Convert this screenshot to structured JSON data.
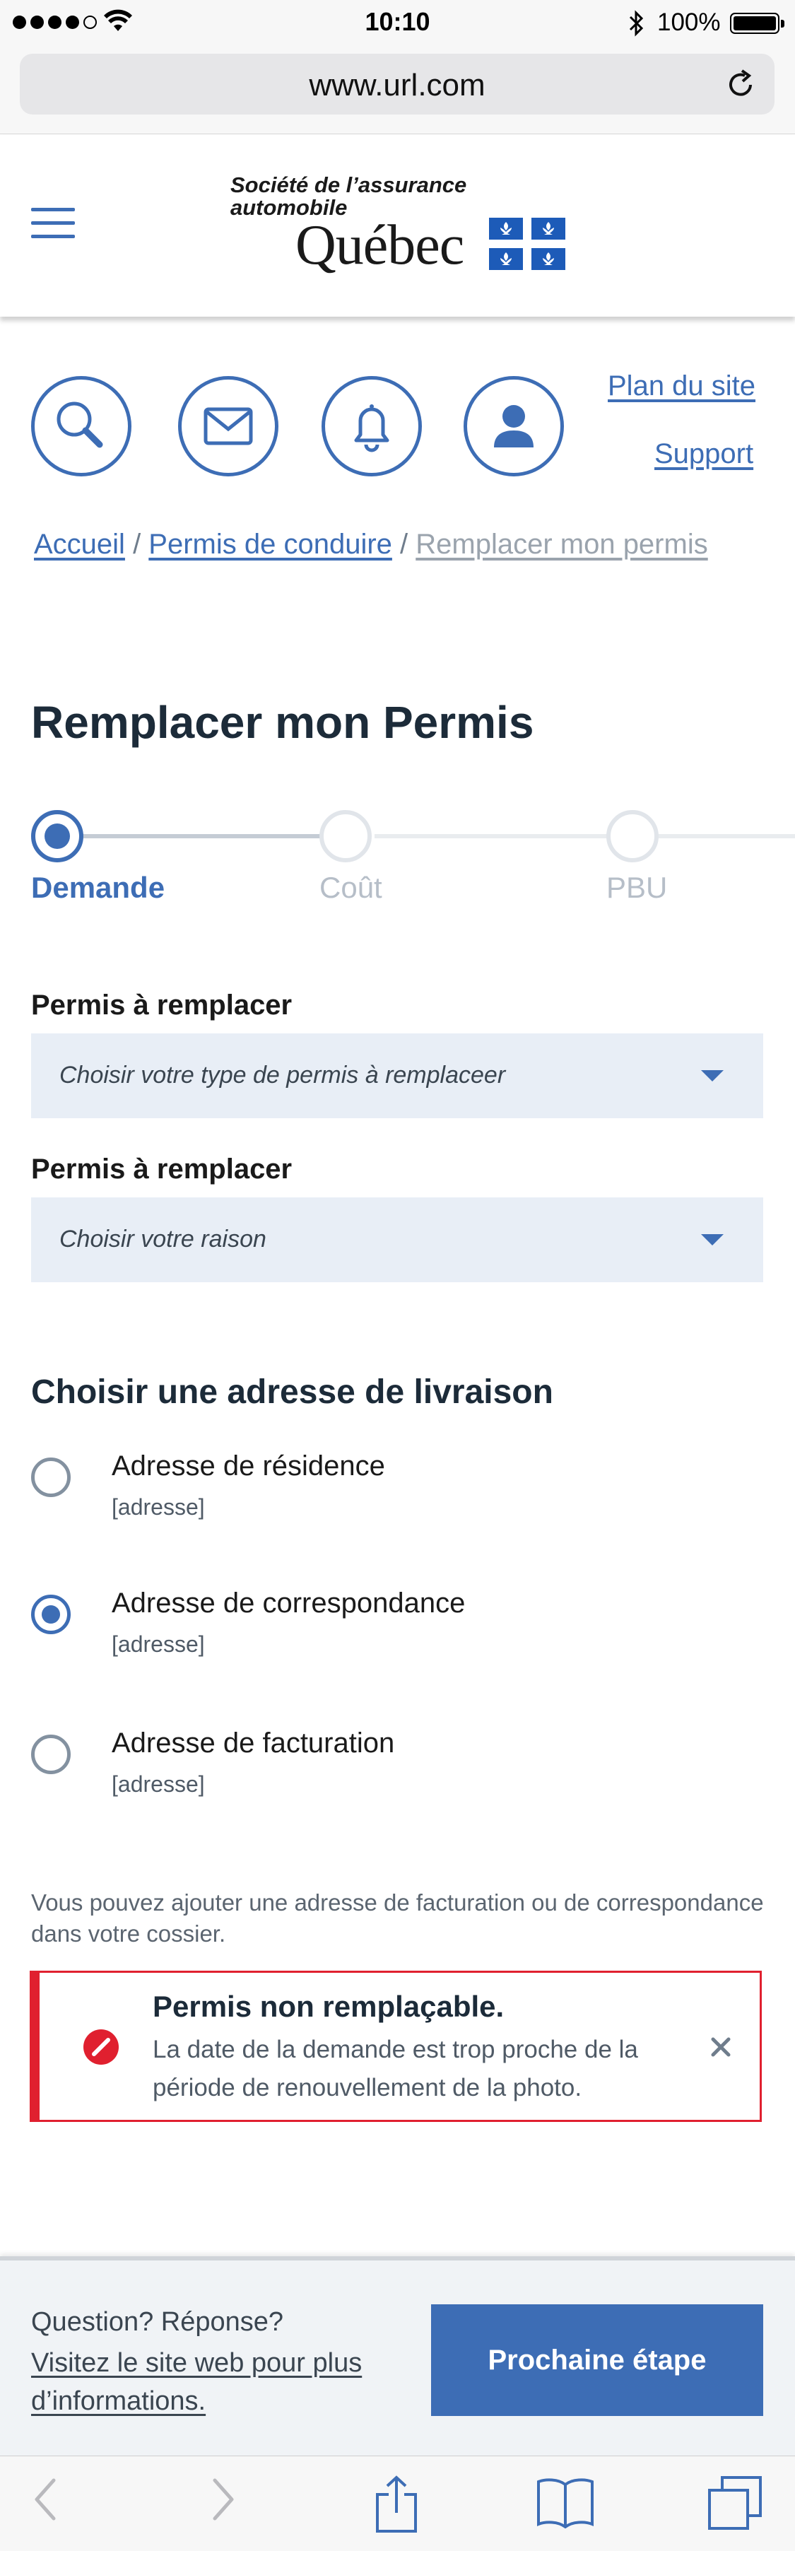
{
  "status_bar": {
    "time": "10:10",
    "battery": "100%",
    "signal_dots": 4
  },
  "browser": {
    "url": "www.url.com",
    "toolbar_icons": [
      "back-arrow-icon",
      "forward-arrow-icon",
      "share-icon",
      "bookmarks-icon",
      "tabs-icon"
    ]
  },
  "header": {
    "logo_line1": "Société de l’assurance",
    "logo_line2": "automobile",
    "logo_city": "Québec",
    "menu_icon": "hamburger-menu-icon"
  },
  "utility_nav": {
    "icons": [
      "search-icon",
      "mail-icon",
      "bell-icon",
      "user-icon"
    ],
    "links": [
      "Plan du site",
      "Support"
    ]
  },
  "breadcrumb": {
    "items": [
      "Accueil",
      "Permis de conduire"
    ],
    "current": "Remplacer mon permis",
    "separator": " / "
  },
  "page": {
    "title": "Remplacer mon Permis"
  },
  "stepper": {
    "steps": [
      "Demande",
      "Coût",
      "PBU"
    ],
    "active_index": 0
  },
  "form": {
    "fields": [
      {
        "label": "Permis à remplacer",
        "placeholder": "Choisir votre type de permis à remplaceer"
      },
      {
        "label": "Permis à remplacer",
        "placeholder": "Choisir votre raison"
      }
    ],
    "delivery": {
      "title": "Choisir une adresse de livraison",
      "options": [
        {
          "label": "Adresse de résidence",
          "sub": "[adresse]",
          "checked": false
        },
        {
          "label": "Adresse de correspondance",
          "sub": "[adresse]",
          "checked": true
        },
        {
          "label": "Adresse de facturation",
          "sub": "[adresse]",
          "checked": false
        }
      ],
      "help": "Vous pouvez ajouter une adresse de facturation ou de correspondance dans votre cossier."
    }
  },
  "alert": {
    "title": "Permis non remplaçable.",
    "body": "La date de la demande est trop proche de la période de renouvellement de la photo.",
    "color": "#e0202f"
  },
  "footer_bar": {
    "question": "Question? Réponse?",
    "link": "Visitez le site web pour plus d’informations.",
    "button": "Prochaine étape"
  },
  "colors": {
    "primary": "#3d6db5",
    "error": "#e0202f",
    "field_bg": "#e8eef6",
    "text_dark": "#1c2b39"
  }
}
